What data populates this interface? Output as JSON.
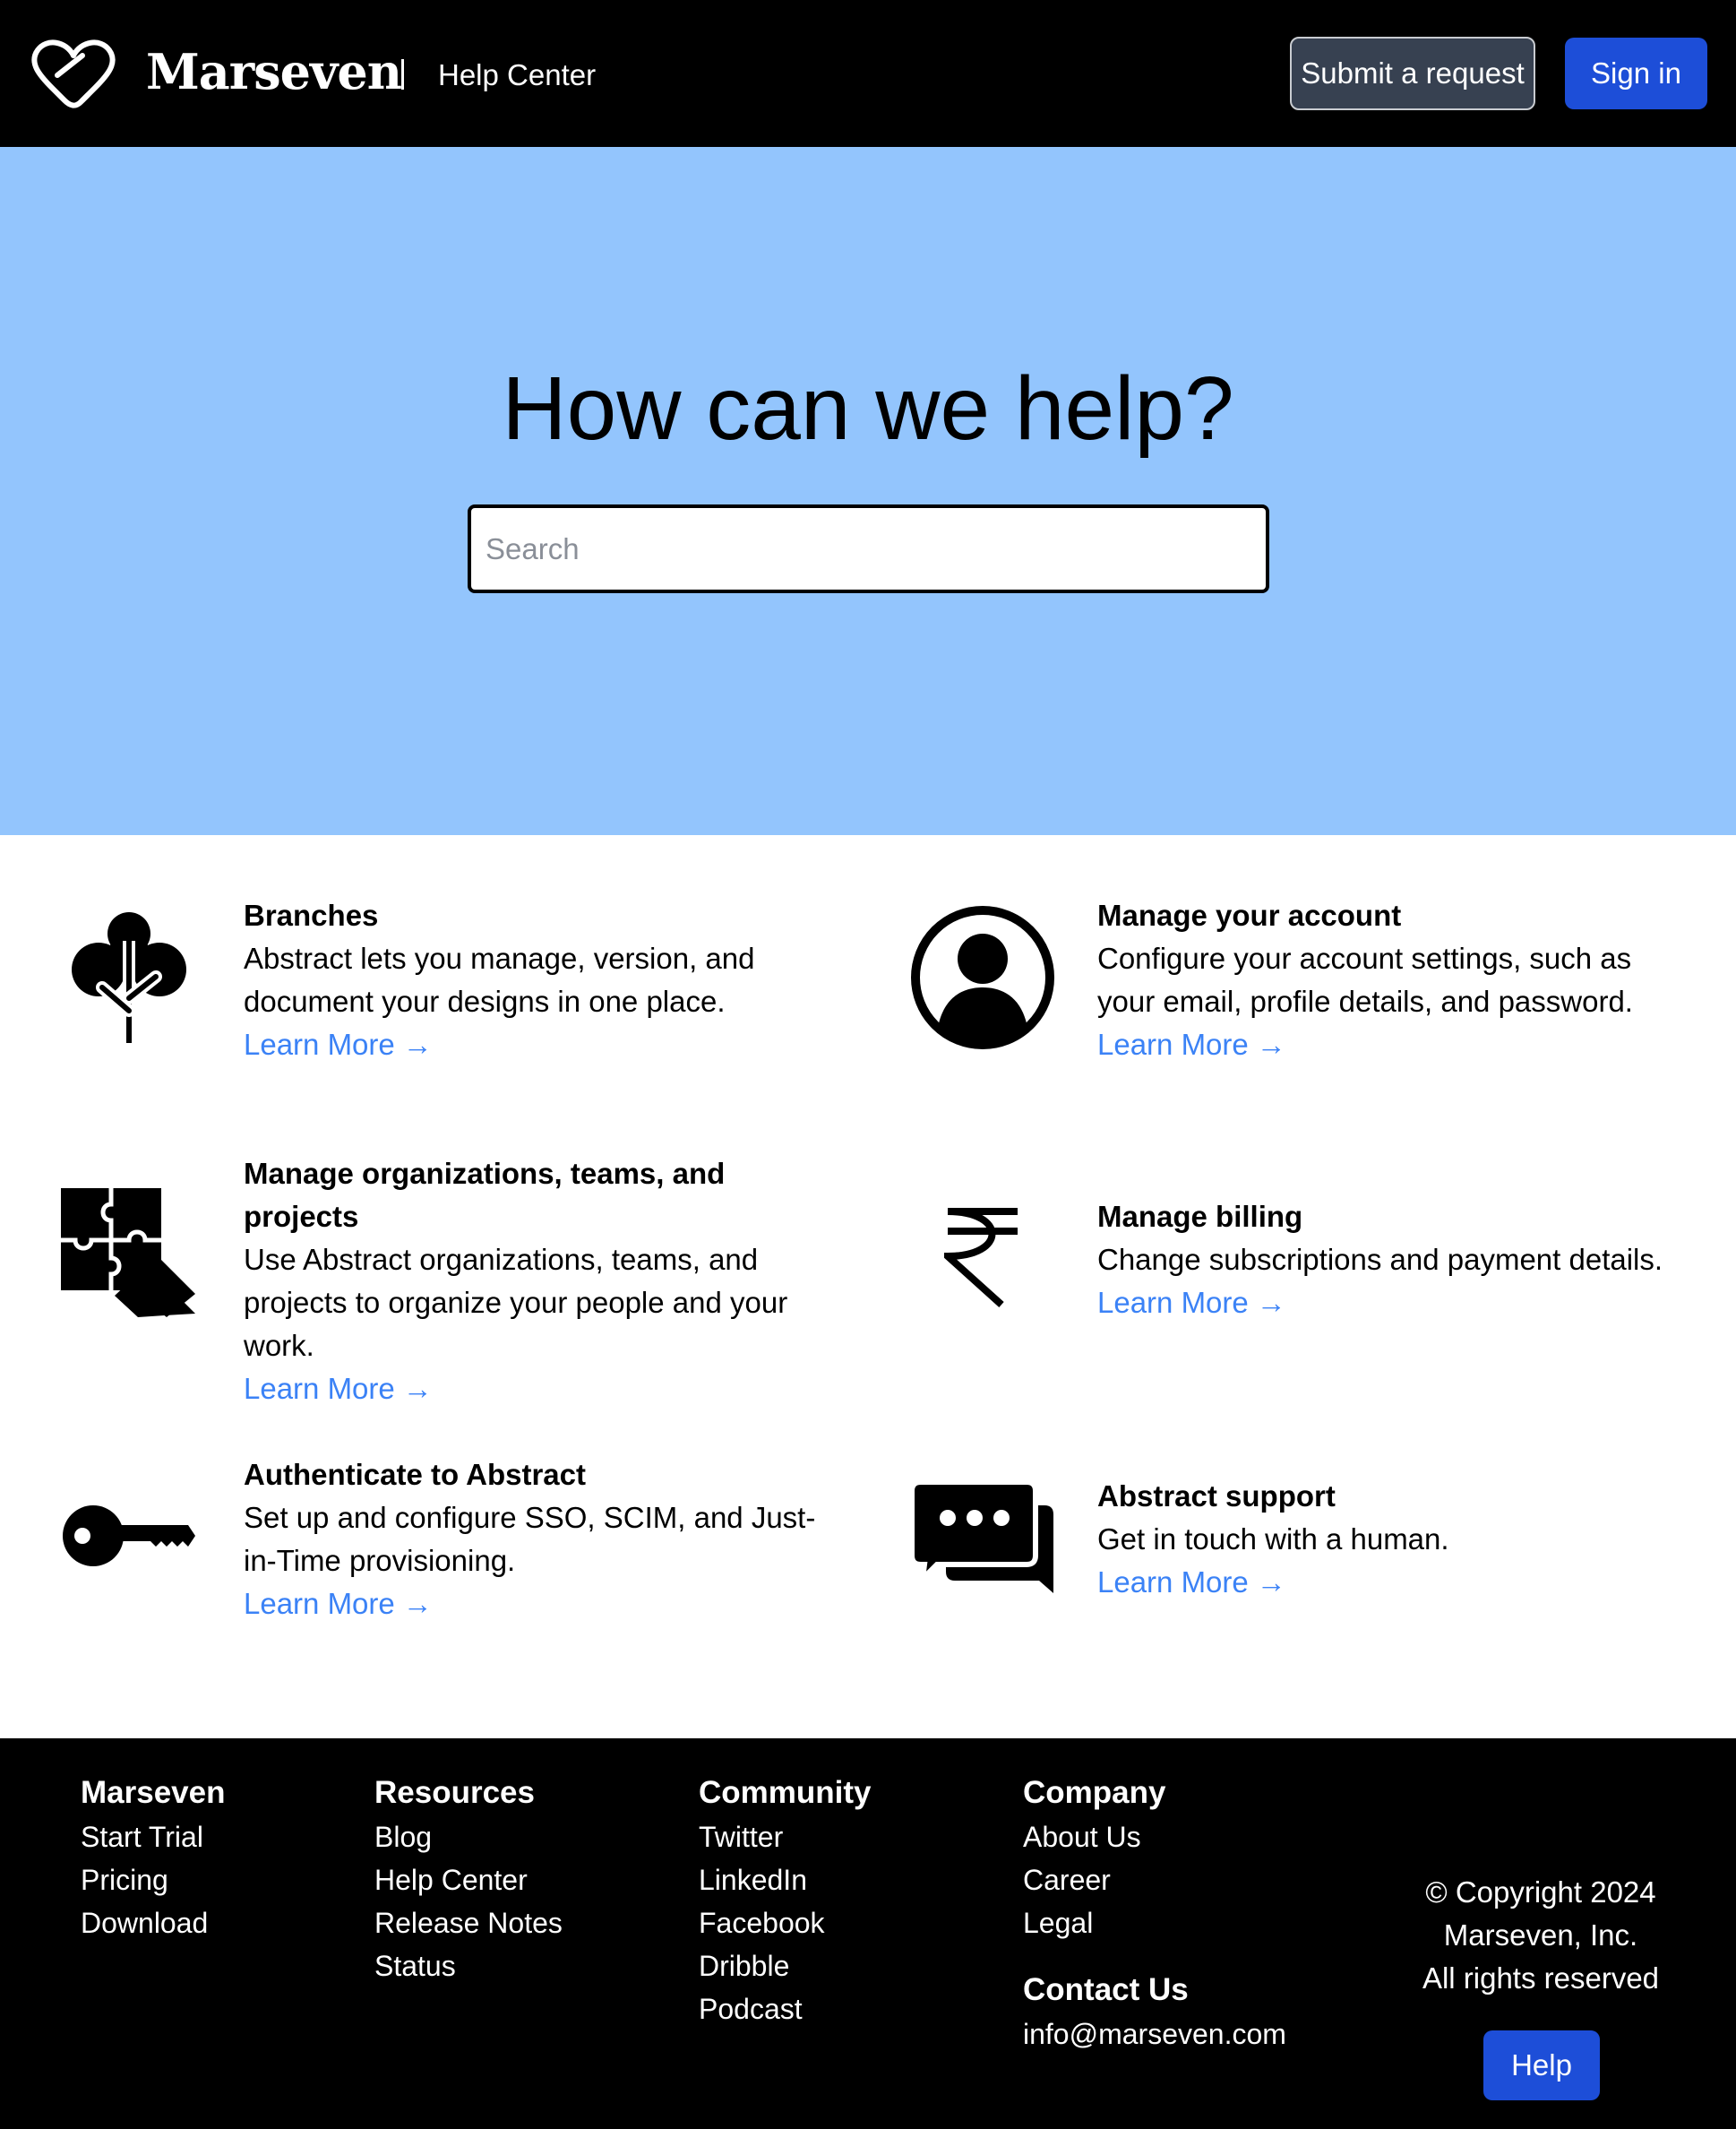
{
  "header": {
    "brand": "Marseven",
    "section": "Help Center",
    "submit_label": "Submit a request",
    "signin_label": "Sign in"
  },
  "hero": {
    "title": "How can we help?",
    "search_placeholder": "Search"
  },
  "cards": [
    {
      "icon": "tree-icon",
      "title": "Branches",
      "desc": "Abstract lets you manage, version, and document your designs in one place.",
      "link": "Learn More →"
    },
    {
      "icon": "user-circle-icon",
      "title": "Manage your account",
      "desc": "Configure your account settings, such as your email, profile details, and password.",
      "link": "Learn More →"
    },
    {
      "icon": "puzzle-icon",
      "title": "Manage organizations, teams, and projects",
      "desc": "Use Abstract organizations, teams, and projects to organize your people and your work.",
      "link": "Learn More →"
    },
    {
      "icon": "rupee-icon",
      "title": "Manage billing",
      "desc": "Change subscriptions and payment details.",
      "link": "Learn More →"
    },
    {
      "icon": "key-icon",
      "title": "Authenticate to Abstract",
      "desc": "Set up and configure SSO, SCIM, and Just-in-Time provisioning.",
      "link": "Learn More →"
    },
    {
      "icon": "chat-bubbles-icon",
      "title": "Abstract support",
      "desc": "Get in touch with a human.",
      "link": "Learn More →"
    }
  ],
  "footer": {
    "marseven": {
      "heading": "Marseven",
      "links": [
        "Start Trial",
        "Pricing",
        "Download"
      ]
    },
    "resources": {
      "heading": "Resources",
      "links": [
        "Blog",
        "Help Center",
        "Release Notes",
        "Status"
      ]
    },
    "community": {
      "heading": "Community",
      "links": [
        "Twitter",
        "LinkedIn",
        "Facebook",
        "Dribble",
        "Podcast"
      ]
    },
    "company": {
      "heading": "Company",
      "links": [
        "About Us",
        "Career",
        "Legal"
      ]
    },
    "contact": {
      "heading": "Contact Us",
      "email": "info@marseven.com"
    },
    "copyright": [
      "© Copyright 2024",
      "Marseven, Inc.",
      "All rights reserved"
    ],
    "help_label": "Help"
  },
  "colors": {
    "header_bg": "#000000",
    "hero_bg": "#93c5fd",
    "primary_button": "#1d4ed8",
    "secondary_button": "#374151",
    "link": "#3b82f6"
  }
}
